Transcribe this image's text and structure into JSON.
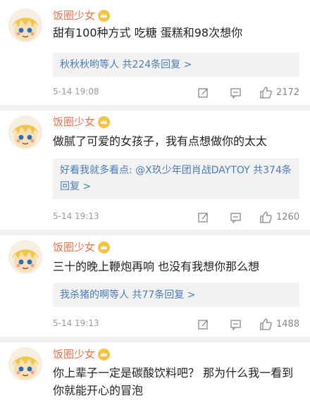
{
  "comments": [
    {
      "username": "饭圈少女",
      "text": "甜有100种方式 吃糖 蛋糕和98次想你",
      "reply_summary": "秋秋秋哟等人 共224条回复 >",
      "reply_parts": [],
      "time": "5-14 19:08",
      "likes": "2172"
    },
    {
      "username": "饭圈少女",
      "text": "做腻了可爱的女孩子，我有点想做你的太太",
      "reply_summary": "好看我就多看点: @X玖少年团肖战DAYTOY 共374条回复 >",
      "time": "5-14 19:13",
      "likes": "1260"
    },
    {
      "username": "饭圈少女",
      "text": "三十的晚上鞭炮再响 也没有我想你那么想",
      "reply_summary": "我杀猪的啊等人 共77条回复 >",
      "time": "5-14 19:13",
      "likes": "1488"
    },
    {
      "username": "饭圈少女",
      "text": "你上辈子一定是碳酸饮料吧？ 那为什么我一看到你就能开心的冒泡"
    }
  ],
  "icons": {
    "share": "share-icon",
    "comment": "comment-icon",
    "like": "like-icon",
    "badge": "crown-badge-icon"
  },
  "colors": {
    "username": "#eb7350",
    "link": "#4a7cb8",
    "reply_bg": "#f2f2f2",
    "meta": "#999999"
  }
}
